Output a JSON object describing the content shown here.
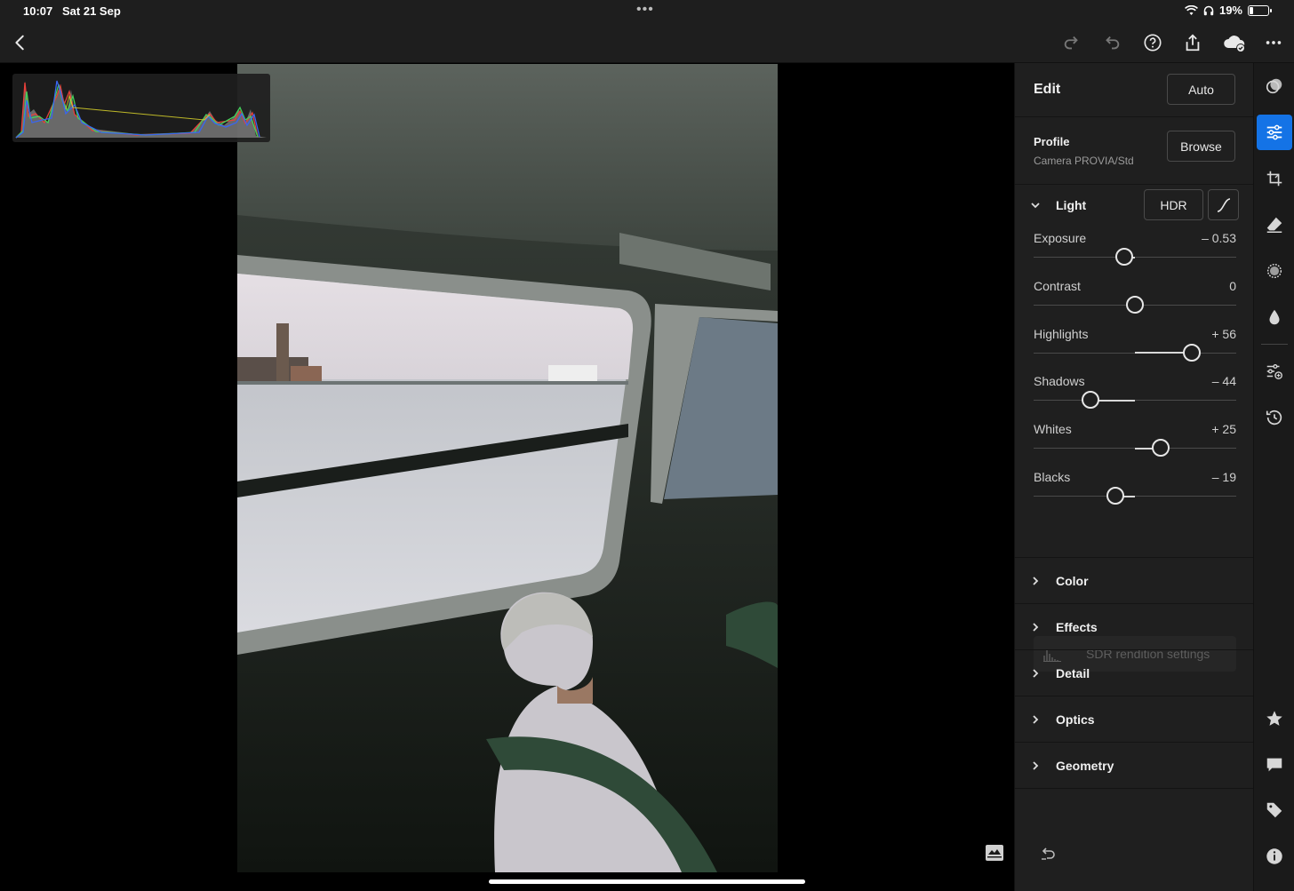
{
  "status_bar": {
    "time": "10:07",
    "date": "Sat 21 Sep",
    "battery": "19%",
    "battery_level": 0.19
  },
  "toolbar": {
    "back_icon": "chevron-left-icon",
    "redo_icon": "redo-icon",
    "undo_icon": "undo-icon",
    "help_icon": "help-circle-icon",
    "share_icon": "share-icon",
    "cloud_icon": "cloud-synced-icon",
    "more_icon": "more-icon"
  },
  "panel": {
    "title": "Edit",
    "auto_label": "Auto",
    "profile": {
      "label": "Profile",
      "value": "Camera PROVIA/Std",
      "browse_label": "Browse"
    },
    "light": {
      "label": "Light",
      "hdr_label": "HDR",
      "sliders": [
        {
          "label": "Exposure",
          "value": "– 0.53",
          "amount": -0.53,
          "min": -5,
          "max": 5
        },
        {
          "label": "Contrast",
          "value": "0",
          "amount": 0,
          "min": -100,
          "max": 100
        },
        {
          "label": "Highlights",
          "value": "+ 56",
          "amount": 56,
          "min": -100,
          "max": 100
        },
        {
          "label": "Shadows",
          "value": "– 44",
          "amount": -44,
          "min": -100,
          "max": 100
        },
        {
          "label": "Whites",
          "value": "+ 25",
          "amount": 25,
          "min": -100,
          "max": 100
        },
        {
          "label": "Blacks",
          "value": "– 19",
          "amount": -19,
          "min": -100,
          "max": 100
        }
      ],
      "sdr_label": "SDR rendition settings"
    },
    "sections": [
      "Color",
      "Effects",
      "Detail",
      "Optics",
      "Geometry"
    ]
  },
  "colors": {
    "accent": "#1473e6",
    "panel_bg": "#1f1f1f"
  }
}
